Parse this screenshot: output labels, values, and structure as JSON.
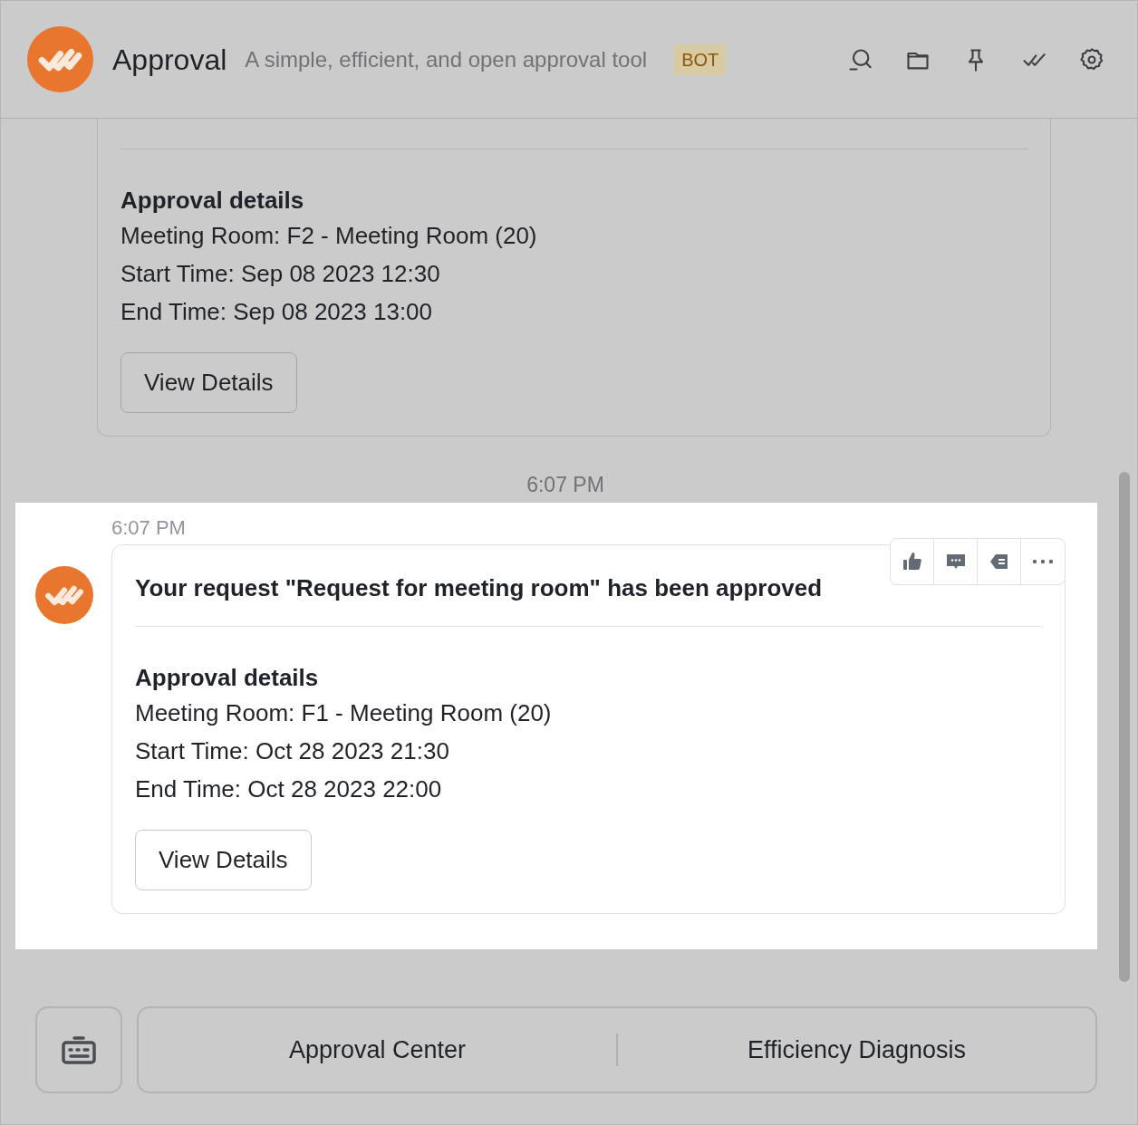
{
  "header": {
    "title": "Approval",
    "subtitle": "A simple, efficient, and open approval tool",
    "badge": "BOT"
  },
  "messages": [
    {
      "highlighted": false,
      "details_heading": "Approval details",
      "lines": [
        "Meeting Room: F2 - Meeting Room (20)",
        "Start Time: Sep 08 2023 12:30",
        "End Time: Sep 08 2023 13:00"
      ],
      "button": "View Details"
    },
    {
      "highlighted": true,
      "divider_time": "6:07 PM",
      "time": "6:07 PM",
      "title": "Your request \"Request for meeting room\" has been approved",
      "details_heading": "Approval details",
      "lines": [
        "Meeting Room: F1 - Meeting Room (20)",
        "Start Time: Oct 28 2023 21:30",
        "End Time: Oct 28 2023 22:00"
      ],
      "button": "View Details"
    }
  ],
  "menu": [
    "Approval Center",
    "Efficiency Diagnosis"
  ]
}
